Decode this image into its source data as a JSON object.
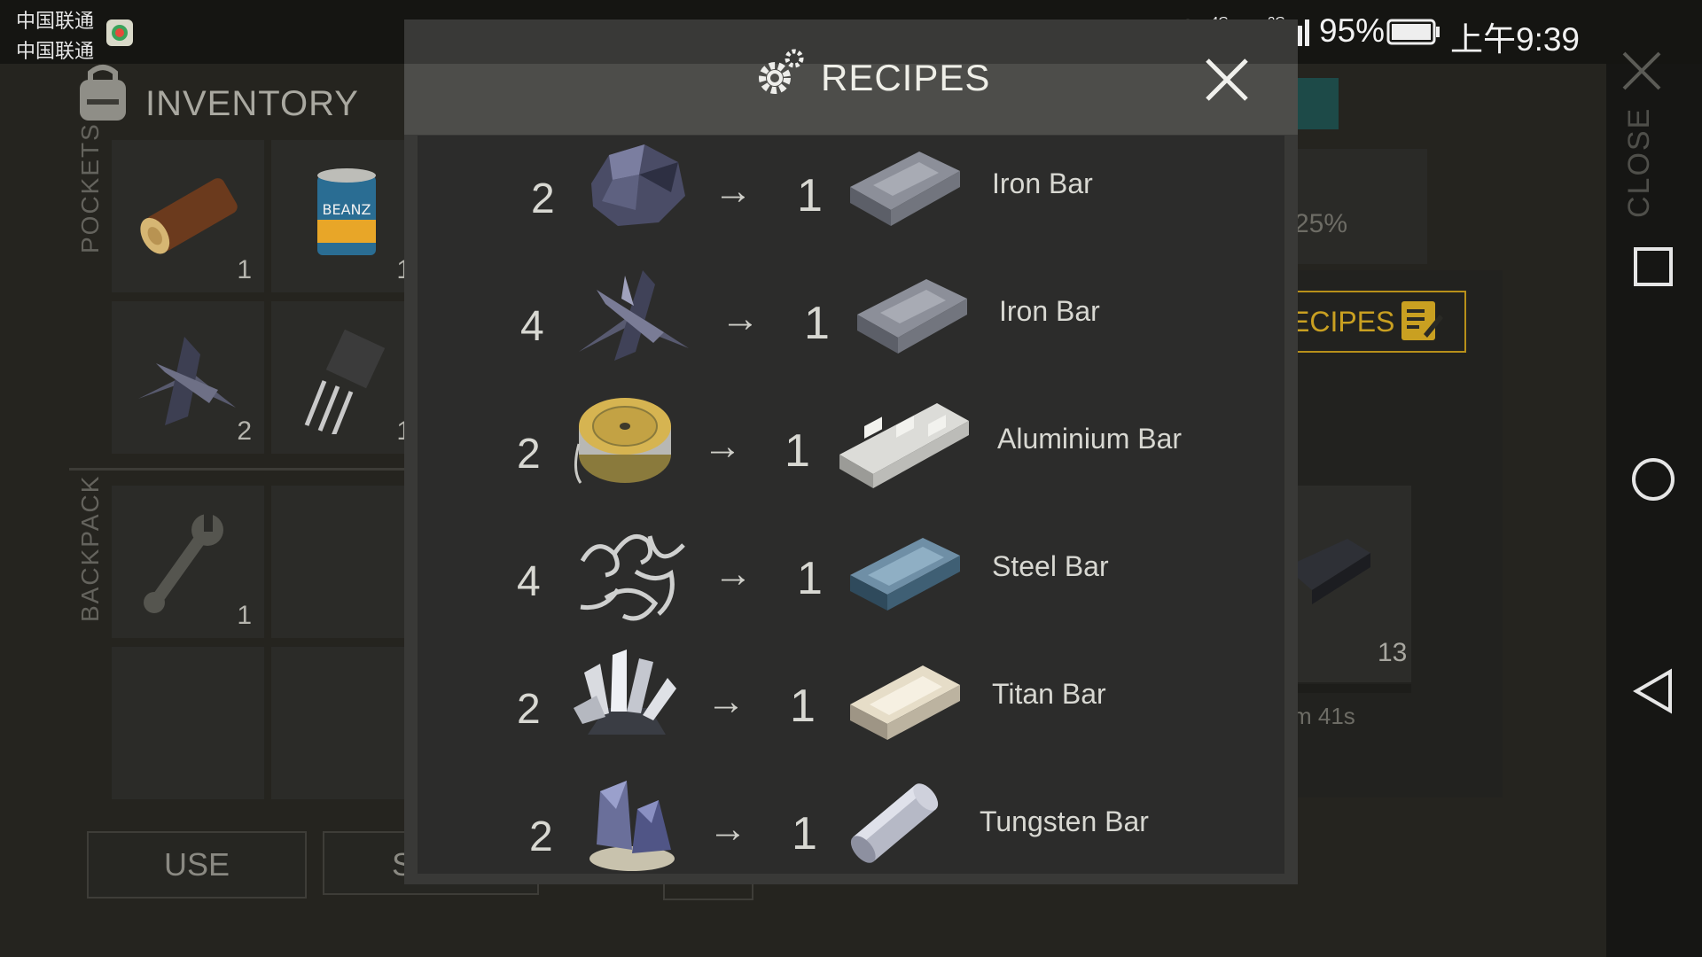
{
  "status_bar": {
    "carrier_1": "中国联通",
    "carrier_2": "中国联通",
    "network_1": "4G",
    "network_2": "2G",
    "battery": "95%",
    "time": "上午9:39"
  },
  "inventory": {
    "title": "INVENTORY",
    "pockets_label": "POCKETS",
    "backpack_label": "BACKPACK",
    "pocket_slots": [
      {
        "item": "log-icon",
        "count": "1"
      },
      {
        "item": "beans-can-icon",
        "count": "1",
        "label": "BEANZ"
      },
      {
        "item": "iron-scrap-icon",
        "count": "2"
      },
      {
        "item": "transistor-icon",
        "count": "1"
      }
    ],
    "backpack_slots": [
      {
        "item": "wrench-icon",
        "count": "1"
      }
    ],
    "buttons": {
      "use": "USE",
      "second": "S"
    }
  },
  "right_side": {
    "percent": "25%",
    "recipes_button": "ECIPES",
    "slot_count": "13",
    "timer": "m 41s",
    "close_label": "CLOSE"
  },
  "modal": {
    "title": "RECIPES",
    "recipes": [
      {
        "input_qty": "2",
        "input_icon": "iron-ore-icon",
        "arrow": "→",
        "output_qty": "1",
        "output_icon": "iron-bar-icon",
        "name": "Iron Bar"
      },
      {
        "input_qty": "4",
        "input_icon": "iron-scrap-icon",
        "arrow": "→",
        "output_qty": "1",
        "output_icon": "iron-bar-icon",
        "name": "Iron Bar"
      },
      {
        "input_qty": "2",
        "input_icon": "wire-spool-icon",
        "arrow": "→",
        "output_qty": "1",
        "output_icon": "aluminium-bar-icon",
        "name": "Aluminium Bar"
      },
      {
        "input_qty": "4",
        "input_icon": "metal-shavings-icon",
        "arrow": "→",
        "output_qty": "1",
        "output_icon": "steel-bar-icon",
        "name": "Steel Bar"
      },
      {
        "input_qty": "2",
        "input_icon": "titan-crystal-icon",
        "arrow": "→",
        "output_qty": "1",
        "output_icon": "titan-bar-icon",
        "name": "Titan Bar"
      },
      {
        "input_qty": "2",
        "input_icon": "tungsten-ore-icon",
        "arrow": "→",
        "output_qty": "1",
        "output_icon": "tungsten-bar-icon",
        "name": "Tungsten Bar"
      }
    ]
  },
  "colors": {
    "accent_gold": "#c9a021",
    "modal_bg": "#393937",
    "list_bg": "#2c2c2b"
  }
}
